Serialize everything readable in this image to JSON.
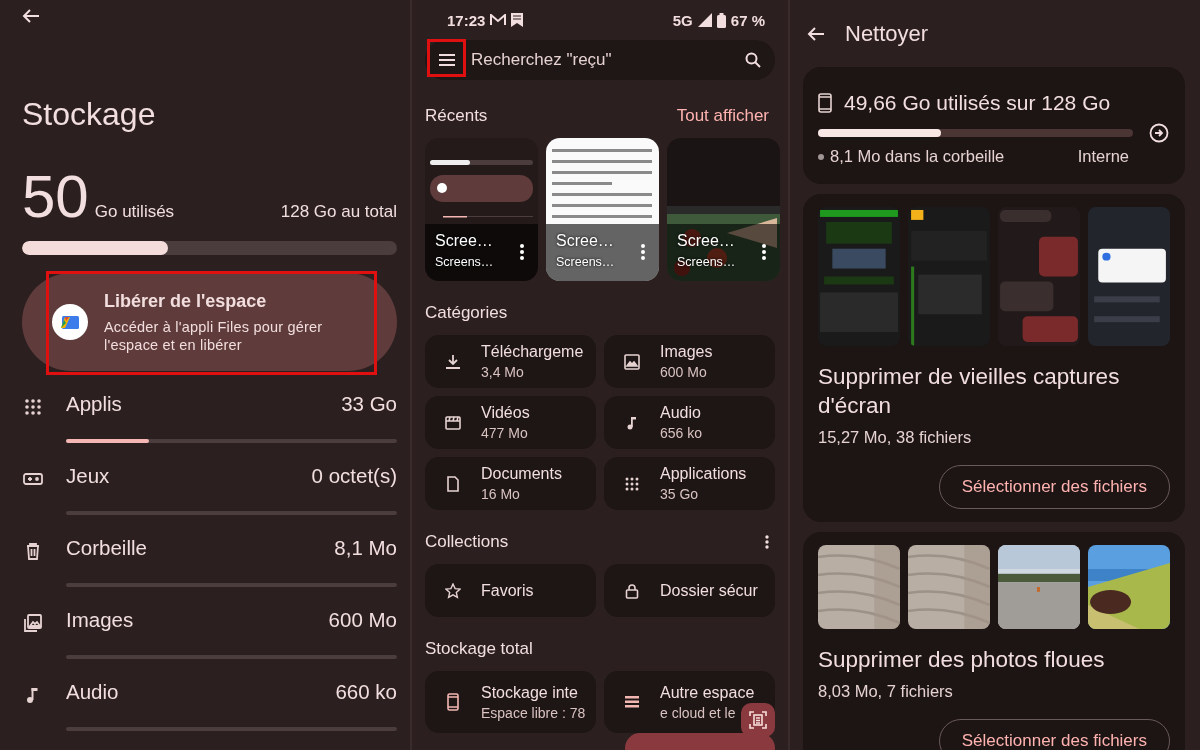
{
  "storage_screen": {
    "title": "Stockage",
    "used_value": "50",
    "used_unit": "Go utilisés",
    "total": "128 Go au total",
    "level": 0.39,
    "free_space_card": {
      "title": "Libérer de l'espace",
      "description": "Accéder à l'appli Files pour gérer l'espace et en libérer",
      "highlighted": true
    },
    "categories": [
      {
        "name": "Applis",
        "size": "33 Go",
        "level": 0.25
      },
      {
        "name": "Jeux",
        "size": "0 octet(s)"
      },
      {
        "name": "Corbeille",
        "size": "8,1 Mo"
      },
      {
        "name": "Images",
        "size": "600 Mo"
      },
      {
        "name": "Audio",
        "size": "660 ko"
      }
    ]
  },
  "files_screen": {
    "status_bar": {
      "time": "17:23",
      "network": "5G",
      "battery": "67 %"
    },
    "search": {
      "placeholder": "Recherchez \"reçu\"",
      "menu_highlighted": true
    },
    "recents": {
      "title": "Récents",
      "action": "Tout afficher",
      "items": [
        {
          "title": "Scree…",
          "subtitle": "Screens…",
          "kind": "storage"
        },
        {
          "title": "Scree…",
          "subtitle": "Screens…",
          "kind": "article"
        },
        {
          "title": "Scree…",
          "subtitle": "Screens…",
          "kind": "garden"
        }
      ]
    },
    "categories": {
      "title": "Catégories",
      "items": [
        {
          "name": "Téléchargeme",
          "size": "3,4 Mo"
        },
        {
          "name": "Images",
          "size": "600 Mo"
        },
        {
          "name": "Vidéos",
          "size": "477 Mo"
        },
        {
          "name": "Audio",
          "size": "656 ko"
        },
        {
          "name": "Documents",
          "size": "16 Mo"
        },
        {
          "name": "Applications",
          "size": "35 Go"
        }
      ]
    },
    "collections": {
      "title": "Collections",
      "items": [
        {
          "name": "Favoris"
        },
        {
          "name": "Dossier sécur"
        }
      ]
    },
    "total_storage": {
      "title": "Stockage total",
      "items": [
        {
          "name": "Stockage inte",
          "detail": "Espace libre : 78"
        },
        {
          "name": "Autre espace",
          "detail": "e cloud et le"
        }
      ]
    }
  },
  "clean_screen": {
    "title": "Nettoyer",
    "storage_card": {
      "usage": "49,66 Go utilisés sur 128 Go",
      "level": 0.39,
      "trash": "8,1 Mo dans la corbeille",
      "location": "Interne"
    },
    "suggestions": [
      {
        "kind": "screenshots",
        "title": "Supprimer de vieilles captures d'écran",
        "detail": "15,27 Mo, 38 fichiers",
        "button": "Sélectionner des fichiers"
      },
      {
        "kind": "photos",
        "title": "Supprimer des photos floues",
        "detail": "8,03 Mo, 7 fichiers",
        "button": "Sélectionner des fichiers"
      }
    ]
  }
}
